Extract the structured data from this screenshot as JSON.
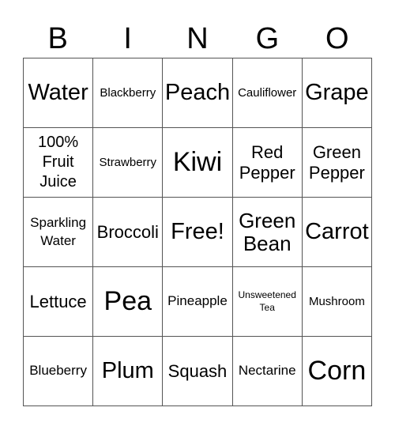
{
  "header": [
    "B",
    "I",
    "N",
    "G",
    "O"
  ],
  "cells": [
    {
      "text": "Water",
      "size": "l"
    },
    {
      "text": "Blackberry",
      "size": "s"
    },
    {
      "text": "Peach",
      "size": "l"
    },
    {
      "text": "Cauliflower",
      "size": "s"
    },
    {
      "text": "Grape",
      "size": "l"
    },
    {
      "text": "100% Fruit Juice",
      "size": "mm"
    },
    {
      "text": "Strawberry",
      "size": "s"
    },
    {
      "text": "Kiwi",
      "size": "xl"
    },
    {
      "text": "Red Pepper",
      "size": "m"
    },
    {
      "text": "Green Pepper",
      "size": "m"
    },
    {
      "text": "Sparkling Water",
      "size": "sm"
    },
    {
      "text": "Broccoli",
      "size": "m"
    },
    {
      "text": "Free!",
      "size": "l"
    },
    {
      "text": "Green Bean",
      "size": "lm"
    },
    {
      "text": "Carrot",
      "size": "l"
    },
    {
      "text": "Lettuce",
      "size": "m"
    },
    {
      "text": "Pea",
      "size": "xl"
    },
    {
      "text": "Pineapple",
      "size": "sm"
    },
    {
      "text": "Unsweetened Tea",
      "size": "xs"
    },
    {
      "text": "Mushroom",
      "size": "s"
    },
    {
      "text": "Blueberry",
      "size": "sm"
    },
    {
      "text": "Plum",
      "size": "l"
    },
    {
      "text": "Squash",
      "size": "m"
    },
    {
      "text": "Nectarine",
      "size": "sm"
    },
    {
      "text": "Corn",
      "size": "xl"
    }
  ]
}
